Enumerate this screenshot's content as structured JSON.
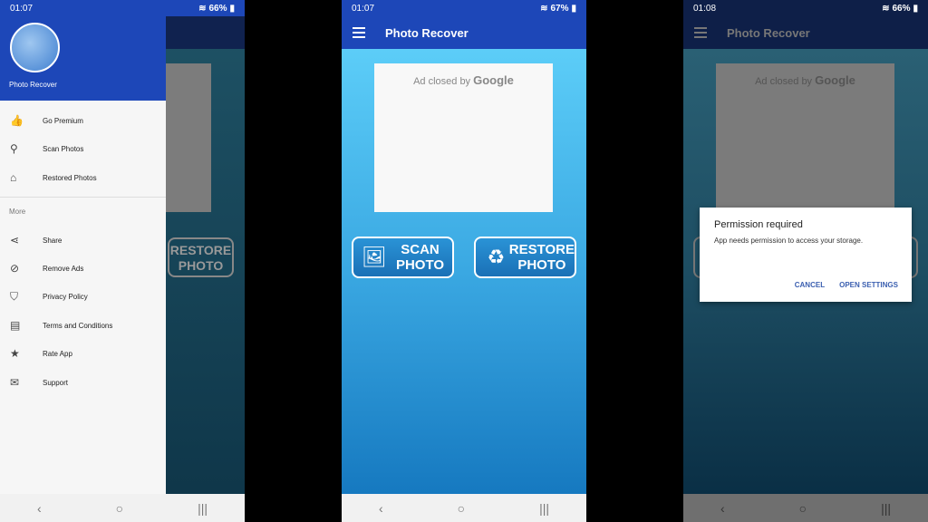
{
  "colors": {
    "primary": "#1d47b8",
    "accent": "#3b5fb0"
  },
  "app_title": "Photo Recover",
  "ad_text": "Ad closed by",
  "ad_brand": "Google",
  "scan_button": {
    "line1": "SCAN",
    "line2": "PHOTO",
    "icon": "image-icon"
  },
  "restore_button": {
    "line1": "RESTORE",
    "line2": "PHOTO",
    "icon": "sync-icon"
  },
  "nav": {
    "back": "‹",
    "home": "○",
    "recents": "|||"
  },
  "screen1": {
    "time": "01:07",
    "battery": "66%",
    "drawer": {
      "title": "Photo Recover",
      "more": "More",
      "items": [
        {
          "label": "Go Premium",
          "icon": "thumbs-up-icon"
        },
        {
          "label": "Scan Photos",
          "icon": "search-icon"
        },
        {
          "label": "Restored Photos",
          "icon": "restore-icon"
        }
      ],
      "more_items": [
        {
          "label": "Share",
          "icon": "share-icon"
        },
        {
          "label": "Remove Ads",
          "icon": "remove-ads-icon"
        },
        {
          "label": "Privacy Policy",
          "icon": "shield-icon"
        },
        {
          "label": "Terms and Conditions",
          "icon": "document-icon"
        },
        {
          "label": "Rate App",
          "icon": "star-icon"
        },
        {
          "label": "Support",
          "icon": "mail-icon"
        }
      ]
    }
  },
  "screen2": {
    "time": "01:07",
    "battery": "67%"
  },
  "screen3": {
    "time": "01:08",
    "battery": "66%",
    "dialog": {
      "title": "Permission required",
      "message": "App needs permission to access your storage.",
      "cancel": "CANCEL",
      "confirm": "OPEN SETTINGS"
    }
  }
}
